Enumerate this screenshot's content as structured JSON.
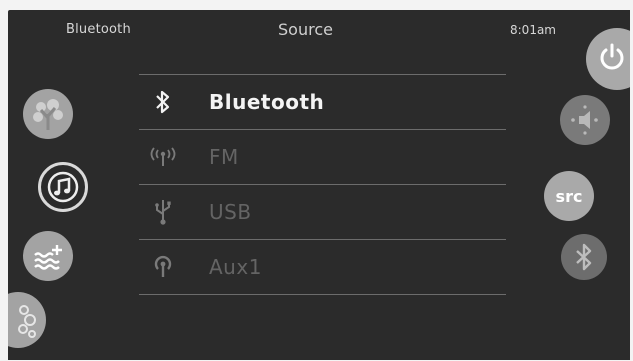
{
  "header": {
    "left_label": "Bluetooth",
    "title": "Source",
    "time": "8:01am"
  },
  "sources": [
    {
      "icon": "bluetooth-icon",
      "label": "Bluetooth",
      "selected": true
    },
    {
      "icon": "radio-antenna-icon",
      "label": "FM",
      "selected": false
    },
    {
      "icon": "usb-icon",
      "label": "USB",
      "selected": false
    },
    {
      "icon": "aux-input-icon",
      "label": "Aux1",
      "selected": false
    }
  ],
  "left_nav": [
    {
      "icon": "tree-icon"
    },
    {
      "icon": "music-note-icon",
      "active": true
    },
    {
      "icon": "water-temperature-icon"
    },
    {
      "icon": "bubbles-icon"
    }
  ],
  "right_nav": {
    "power_icon": "power-icon",
    "volume_icon": "volume-icon",
    "source_label": "src",
    "bluetooth_icon": "bluetooth-icon"
  },
  "colors": {
    "screen_bg": "#2b2b2b",
    "text_active": "#f4f4f4",
    "text_inactive": "#646464",
    "circle_light": "#a3a3a3"
  }
}
